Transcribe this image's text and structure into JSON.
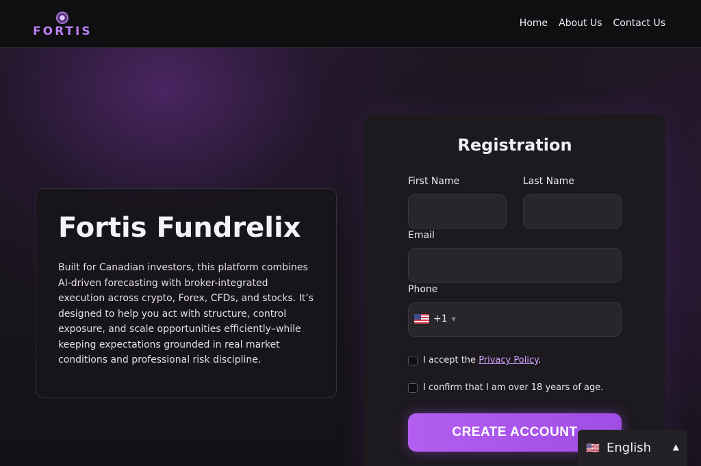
{
  "header": {
    "logo_text": "FORTIS",
    "nav": [
      {
        "label": "Home"
      },
      {
        "label": "About Us"
      },
      {
        "label": "Contact Us"
      }
    ]
  },
  "hero": {
    "title": "Fortis Fundrelix",
    "description": "Built for Canadian investors, this platform combines AI-driven forecasting with broker-integrated execution across crypto, Forex, CFDs, and stocks. It’s designed to help you act with structure, control exposure, and scale opportunities efficiently–while keeping expectations grounded in real market conditions and professional risk discipline."
  },
  "registration": {
    "title": "Registration",
    "first_name_label": "First Name",
    "first_name_value": "",
    "last_name_label": "Last Name",
    "last_name_value": "",
    "email_label": "Email",
    "email_value": "",
    "phone_label": "Phone",
    "phone_code": "+1",
    "phone_country_icon": "us-flag-icon",
    "phone_value": "",
    "privacy_text": "I accept the",
    "privacy_link": "Privacy Policy",
    "privacy_suffix": ".",
    "age_text": "I confirm that I am over 18 years of age.",
    "submit_label": "CREATE ACCOUNT"
  },
  "language": {
    "flag_glyph": "🇺🇸",
    "label": "English",
    "arrow": "▲"
  },
  "colors": {
    "accent": "#b25ef0",
    "link": "#d2a3ff",
    "header_bg": "#0f0e11",
    "card_bg": "#1c191f"
  }
}
